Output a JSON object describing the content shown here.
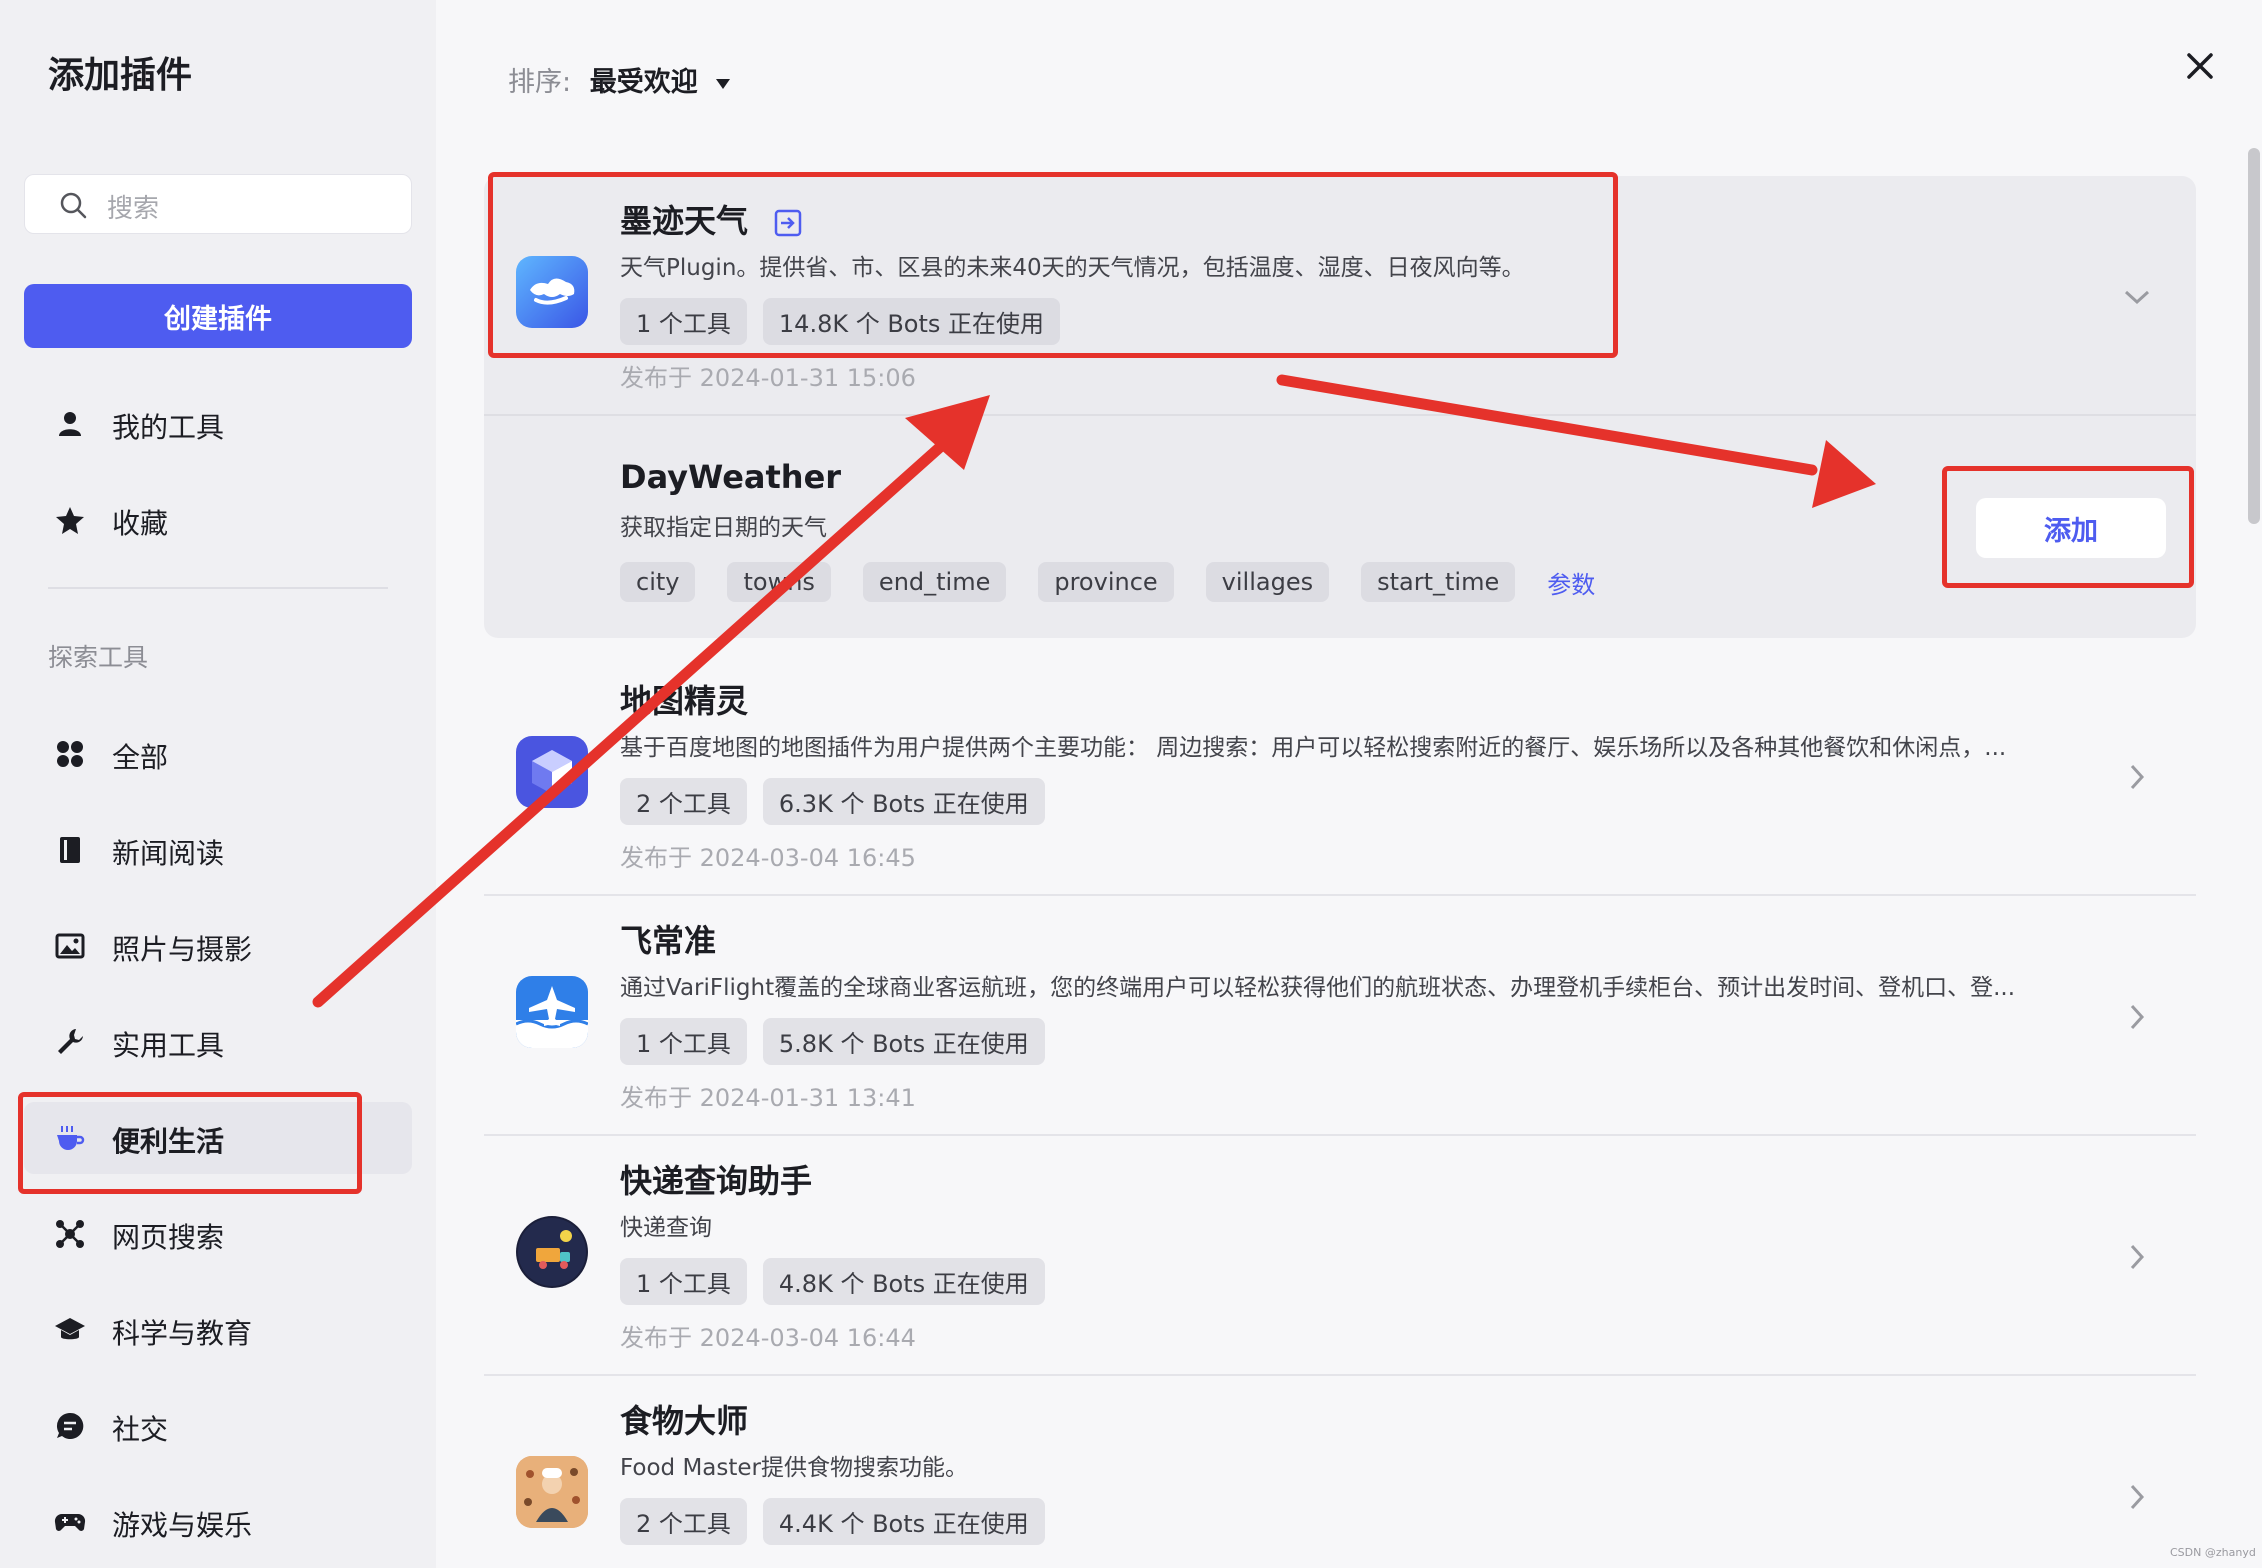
{
  "sidebar": {
    "title": "添加插件",
    "search_placeholder": "搜索",
    "create_button": "创建插件",
    "my_items": [
      {
        "label": "我的工具",
        "icon": "user-icon"
      },
      {
        "label": "收藏",
        "icon": "star-icon"
      }
    ],
    "section_title": "探索工具",
    "categories": [
      {
        "label": "全部",
        "icon": "grid-icon"
      },
      {
        "label": "新闻阅读",
        "icon": "book-icon"
      },
      {
        "label": "照片与摄影",
        "icon": "image-icon"
      },
      {
        "label": "实用工具",
        "icon": "wrench-icon"
      },
      {
        "label": "便利生活",
        "icon": "coffee-icon",
        "active": true
      },
      {
        "label": "网页搜索",
        "icon": "network-icon"
      },
      {
        "label": "科学与教育",
        "icon": "graduation-icon"
      },
      {
        "label": "社交",
        "icon": "chat-icon"
      },
      {
        "label": "游戏与娱乐",
        "icon": "gamepad-icon"
      }
    ]
  },
  "sort": {
    "label": "排序:",
    "value": "最受欢迎"
  },
  "plugins": [
    {
      "name": "墨迹天气",
      "description": "天气Plugin。提供省、市、区县的未来40天的天气情况，包括温度、湿度、日夜风向等。",
      "tools": "1 个工具",
      "bots": "14.8K 个 Bots 正在使用",
      "date": "发布于 2024-01-31 15:06"
    },
    {
      "name": "地图精灵",
      "description": "基于百度地图的地图插件为用户提供两个主要功能： 周边搜索：用户可以轻松搜索附近的餐厅、娱乐场所以及各种其他餐饮和休闲点，...",
      "tools": "2 个工具",
      "bots": "6.3K 个 Bots 正在使用",
      "date": "发布于 2024-03-04 16:45"
    },
    {
      "name": "飞常准",
      "description": "通过VariFlight覆盖的全球商业客运航班，您的终端用户可以轻松获得他们的航班状态、办理登机手续柜台、预计出发时间、登机口、登...",
      "tools": "1 个工具",
      "bots": "5.8K 个 Bots 正在使用",
      "date": "发布于 2024-01-31 13:41"
    },
    {
      "name": "快递查询助手",
      "description": "快递查询",
      "tools": "1 个工具",
      "bots": "4.8K 个 Bots 正在使用",
      "date": "发布于 2024-03-04 16:44"
    },
    {
      "name": "食物大师",
      "description": "Food Master提供食物搜索功能。",
      "tools": "2 个工具",
      "bots": "4.4K 个 Bots 正在使用",
      "date": ""
    }
  ],
  "tool_detail": {
    "name": "DayWeather",
    "description": "获取指定日期的天气",
    "params": [
      "city",
      "towns",
      "end_time",
      "province",
      "villages",
      "start_time"
    ],
    "params_link": "参数",
    "add_button": "添加"
  },
  "watermark": "CSDN @zhanyd",
  "colors": {
    "accent": "#4e5cf0",
    "annotation_red": "#e5322b"
  }
}
